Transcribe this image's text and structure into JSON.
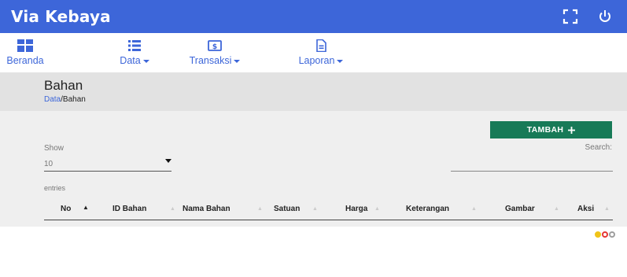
{
  "app": {
    "title": "Via Kebaya"
  },
  "topbar": {
    "fullscreen_icon": "fullscreen-icon",
    "power_icon": "power-icon"
  },
  "nav": [
    {
      "label": "Beranda",
      "icon": "dashboard-icon",
      "dropdown": false
    },
    {
      "label": "Data",
      "icon": "list-icon",
      "dropdown": true
    },
    {
      "label": "Transaksi",
      "icon": "money-icon",
      "dropdown": true
    },
    {
      "label": "Laporan",
      "icon": "document-icon",
      "dropdown": true
    }
  ],
  "page": {
    "title": "Bahan",
    "breadcrumb": {
      "link": "Data",
      "current": "/Bahan"
    }
  },
  "toolbar": {
    "add_label": "TAMBAH",
    "add_icon": "plus"
  },
  "table_controls": {
    "show_label": "Show",
    "page_size": "10",
    "entries_label": "entries",
    "search_label": "Search:",
    "search_value": ""
  },
  "table": {
    "columns": [
      "No",
      "ID Bahan",
      "Nama Bahan",
      "Satuan",
      "Harga",
      "Keterangan",
      "Gambar",
      "Aksi"
    ]
  },
  "colors": {
    "primary": "#3d66d9",
    "add_button": "#177a57",
    "action_edit": "#f0c419",
    "action_delete": "#e53935",
    "action_view": "#9e9e9e"
  }
}
